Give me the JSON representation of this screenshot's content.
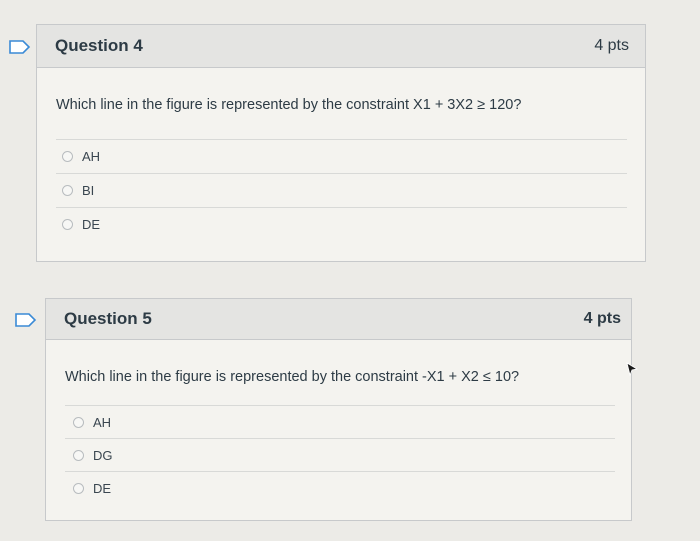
{
  "colors": {
    "flag_border": "#3a8ad6",
    "card_background": "#f4f3ef",
    "header_background": "#e4e4e2",
    "text": "#2d3b45"
  },
  "questions": [
    {
      "title": "Question 4",
      "points": "4 pts",
      "prompt": "Which line in the figure is represented by the constraint X1 + 3X2 ≥ 120?",
      "answers": [
        {
          "label": "AH",
          "selected": false
        },
        {
          "label": "BI",
          "selected": false
        },
        {
          "label": "DE",
          "selected": false
        }
      ]
    },
    {
      "title": "Question 5",
      "points": "4 pts",
      "prompt": "Which line in the figure is represented by the constraint -X1 + X2 ≤ 10?",
      "answers": [
        {
          "label": "AH",
          "selected": false
        },
        {
          "label": "DG",
          "selected": false
        },
        {
          "label": "DE",
          "selected": false
        }
      ]
    }
  ],
  "icons": {
    "flag": "flag-question-icon",
    "radio": "radio-button-icon",
    "cursor": "mouse-pointer-icon"
  }
}
